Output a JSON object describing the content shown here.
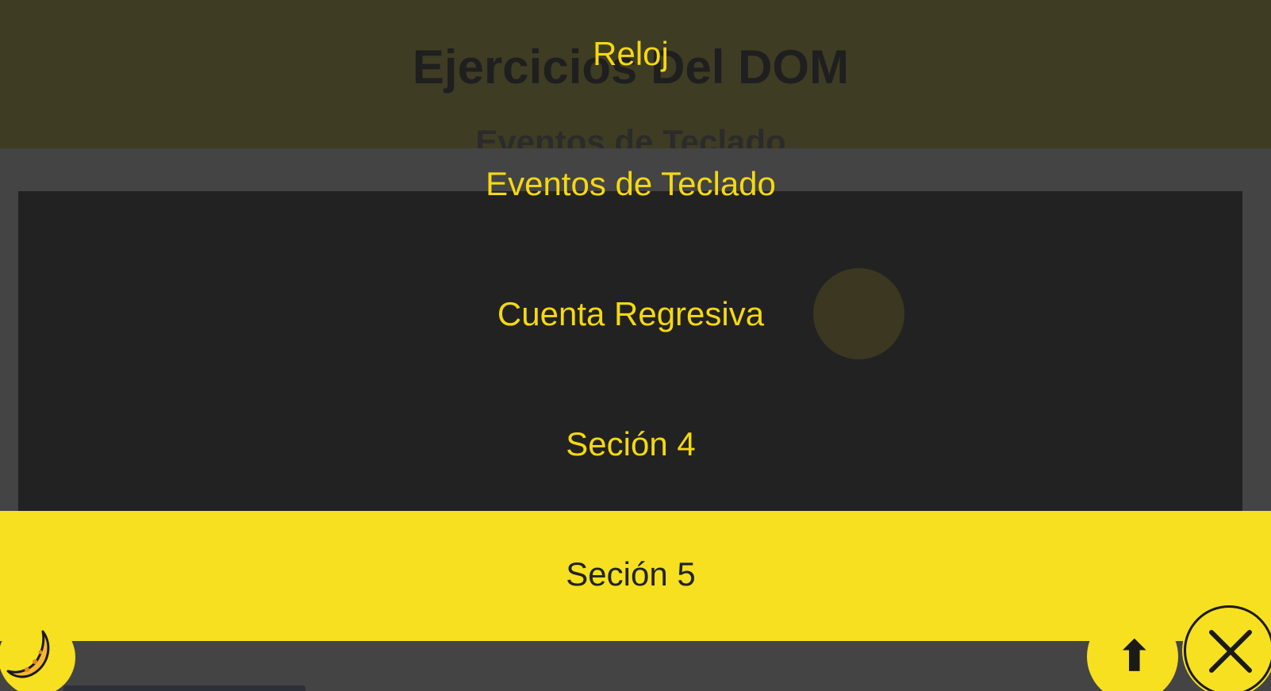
{
  "header": {
    "title": "Ejercicios Del DOM",
    "partial_heading": "Eventos de Teclado"
  },
  "menu": {
    "items": [
      {
        "label": "Reloj"
      },
      {
        "label": "Eventos de Teclado"
      },
      {
        "label": "Cuenta Regresiva"
      },
      {
        "label": "Seción 4"
      },
      {
        "label": "Seción 5"
      }
    ]
  },
  "buttons": {
    "dark_mode_icon": "moon-icon",
    "scroll_top_label": "⬆",
    "close_icon": "close-icon"
  },
  "colors": {
    "accent": "#f6e020",
    "menu_text": "#f5d90f",
    "panel": "#222222",
    "background": "#444444"
  }
}
